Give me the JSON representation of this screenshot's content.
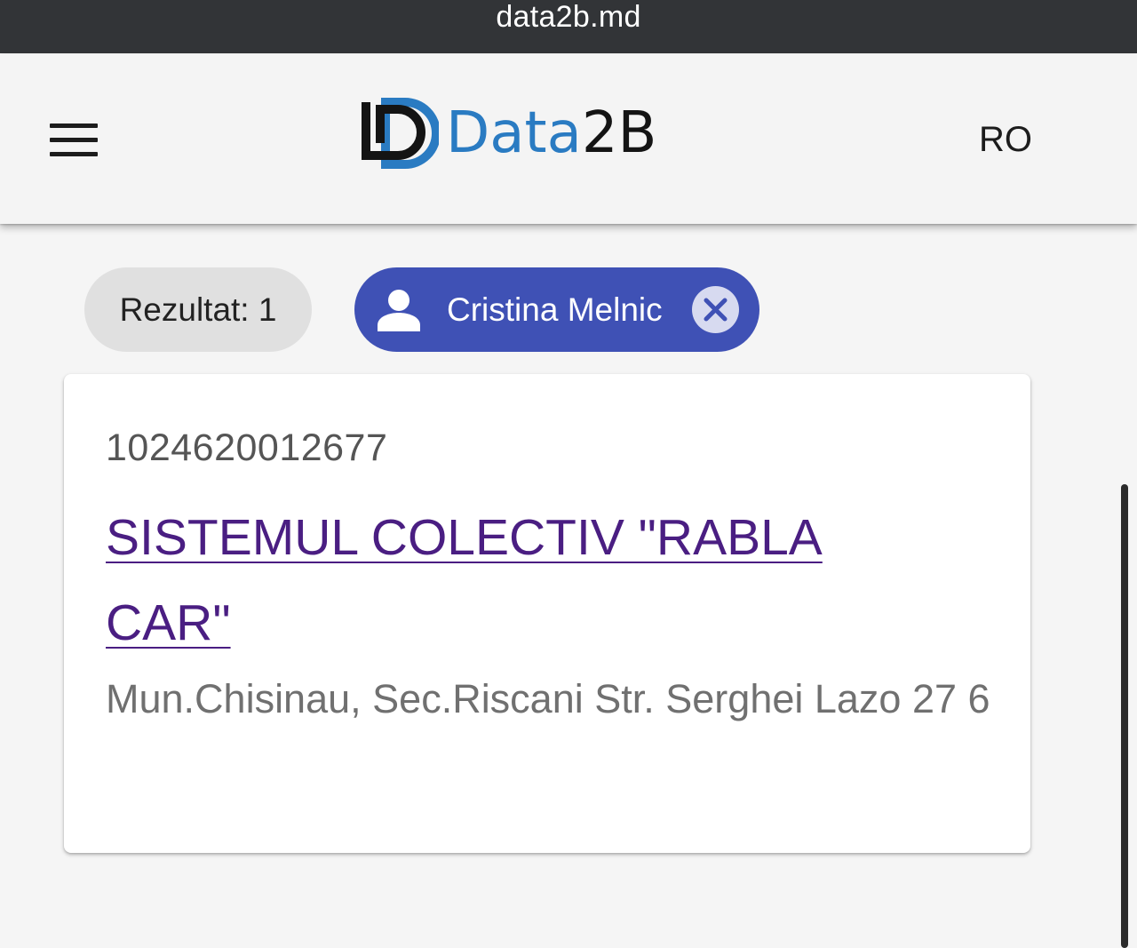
{
  "browser": {
    "url": "data2b.md"
  },
  "header": {
    "menu_icon": "hamburger-menu-icon",
    "logo": {
      "text_part1": "Data",
      "text_part2": "2B",
      "mark_icon": "data2b-logo-mark",
      "colors": {
        "blue": "#2a7bc2",
        "dark": "#141414"
      }
    },
    "language": "RO"
  },
  "filters": {
    "result_count": "Rezultat: 1",
    "person_chip": {
      "name": "Cristina Melnic",
      "icon": "person-icon",
      "close_icon": "close-icon",
      "color": "#3f51b5"
    }
  },
  "results": [
    {
      "idno": "1024620012677",
      "name": "SISTEMUL COLECTIV \"RABLA CAR\"",
      "address": "Mun.Chisinau, Sec.Riscani Str. Serghei Lazo 27 6",
      "link_color": "#4a1e82"
    }
  ]
}
